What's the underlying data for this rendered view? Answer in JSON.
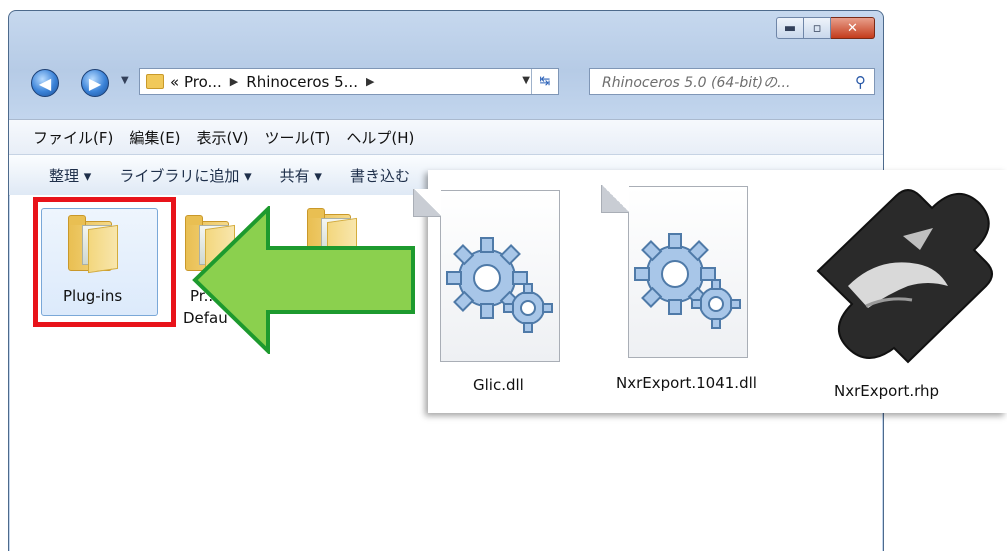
{
  "window": {
    "caption_buttons": {
      "minimize": "▬",
      "maximize": "▫",
      "close": "✕"
    },
    "address_segments": [
      "«  Pro...",
      "Rhinoceros 5..."
    ],
    "search_placeholder": "Rhinoceros 5.0 (64-bit)の...",
    "menu": [
      "ファイル(F)",
      "編集(E)",
      "表示(V)",
      "ツール(T)",
      "ヘルプ(H)"
    ],
    "commands": [
      "整理 ▾",
      "ライブラリに追加 ▾",
      "共有 ▾",
      "書き込む",
      "»"
    ]
  },
  "folders": [
    {
      "name": "Plug-ins",
      "selected": true
    },
    {
      "name": "Pr..."
    },
    {
      "name": ""
    }
  ],
  "folder_partial_text": "Defau",
  "overlay_files": [
    {
      "name": "Glic.dll",
      "icon": "gears-document-icon"
    },
    {
      "name": "NxrExport.1041.dll",
      "icon": "gears-document-icon"
    },
    {
      "name": "NxrExport.rhp",
      "icon": "rhino-plugin-icon"
    }
  ],
  "colors": {
    "highlight": "#e8131a",
    "arrow_fill": "#8bd04e",
    "arrow_stroke": "#1d9a2e"
  }
}
